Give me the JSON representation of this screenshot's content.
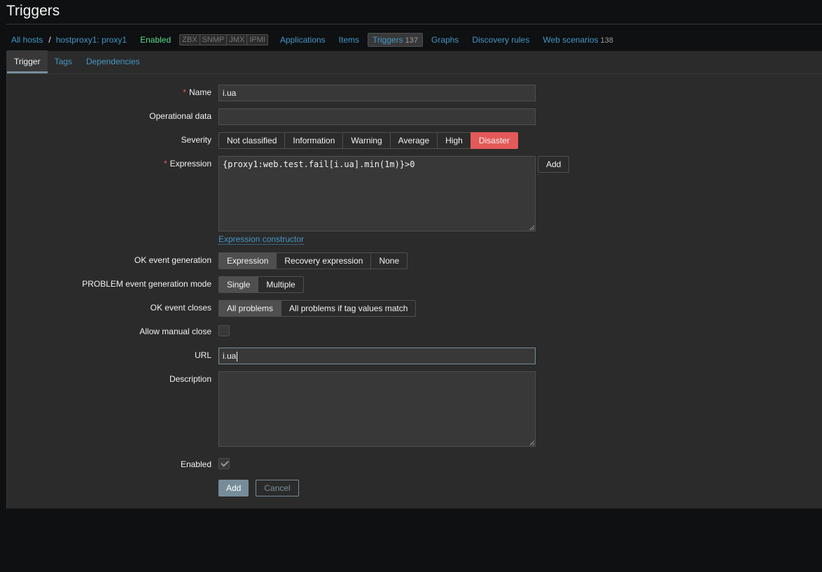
{
  "page": {
    "title": "Triggers"
  },
  "nav": {
    "all_hosts": "All hosts",
    "separator": "/",
    "host": "hostproxy1: proxy1",
    "status": "Enabled",
    "availability": [
      "ZBX",
      "SNMP",
      "JMX",
      "IPMI"
    ],
    "applications": "Applications",
    "items": "Items",
    "triggers": "Triggers",
    "triggers_count": "137",
    "graphs": "Graphs",
    "discovery_rules": "Discovery rules",
    "web_scenarios": "Web scenarios",
    "web_scenarios_count": "138"
  },
  "tabs": {
    "trigger": "Trigger",
    "tags": "Tags",
    "dependencies": "Dependencies"
  },
  "form": {
    "required_mark": "*",
    "name_label": "Name",
    "name_value": "i.ua",
    "opdata_label": "Operational data",
    "opdata_value": "",
    "severity_label": "Severity",
    "severities": [
      "Not classified",
      "Information",
      "Warning",
      "Average",
      "High",
      "Disaster"
    ],
    "severity_selected": "Disaster",
    "expression_label": "Expression",
    "expression_value": "{proxy1:web.test.fail[i.ua].min(1m)}>0",
    "expression_add": "Add",
    "expression_constructor": "Expression constructor",
    "ok_event_generation_label": "OK event generation",
    "ok_event_generation_options": [
      "Expression",
      "Recovery expression",
      "None"
    ],
    "problem_mode_label": "PROBLEM event generation mode",
    "problem_mode_options": [
      "Single",
      "Multiple"
    ],
    "ok_event_closes_label": "OK event closes",
    "ok_event_closes_options": [
      "All problems",
      "All problems if tag values match"
    ],
    "allow_manual_close_label": "Allow manual close",
    "allow_manual_close": false,
    "url_label": "URL",
    "url_value": "i.ua",
    "description_label": "Description",
    "description_value": "",
    "enabled_label": "Enabled",
    "enabled": true,
    "add_button": "Add",
    "cancel_button": "Cancel"
  },
  "colors": {
    "link": "#4796c4",
    "disaster": "#e45959",
    "enabled": "#59db8f",
    "primary": "#768d99"
  }
}
